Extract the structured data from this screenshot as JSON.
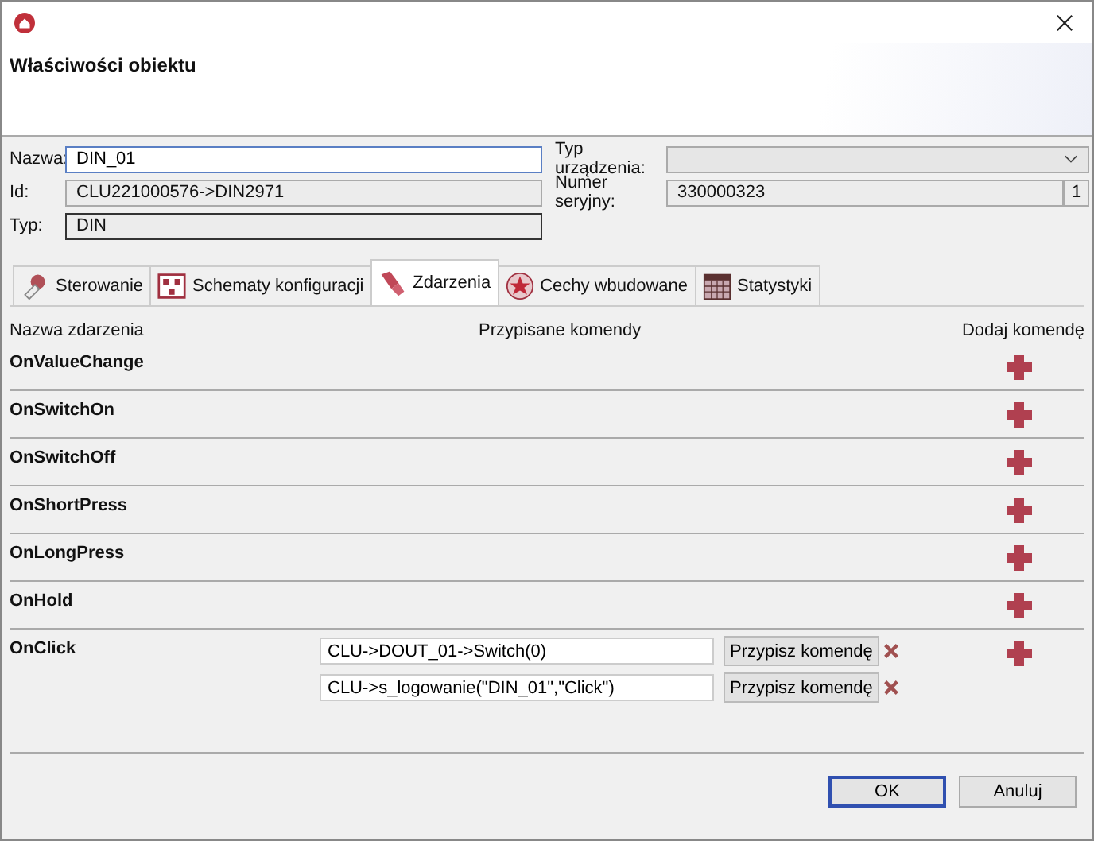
{
  "window": {
    "title": "Właściwości obiektu"
  },
  "fields": {
    "name": {
      "label": "Nazwa:",
      "value": "DIN_01"
    },
    "id": {
      "label": "Id:",
      "value": "CLU221000576->DIN2971"
    },
    "type": {
      "label": "Typ:",
      "value": "DIN"
    },
    "device_type": {
      "label": "Typ urządzenia:"
    },
    "serial": {
      "label": "Numer seryjny:",
      "value": "330000323",
      "extra": "1"
    }
  },
  "tabs": [
    {
      "label": "Sterowanie",
      "selected": false,
      "kind": "hand"
    },
    {
      "label": "Schematy konfiguracji",
      "selected": false,
      "kind": "schema"
    },
    {
      "label": "Zdarzenia",
      "selected": true,
      "kind": "brush"
    },
    {
      "label": "Cechy wbudowane",
      "selected": false,
      "kind": "star"
    },
    {
      "label": "Statystyki",
      "selected": false,
      "kind": "calendar"
    }
  ],
  "table": {
    "columns": [
      "Nazwa zdarzenia",
      "Przypisane komendy",
      "Dodaj komendę"
    ],
    "rows": [
      {
        "name": "OnValueChange",
        "commands": []
      },
      {
        "name": "OnSwitchOn",
        "commands": []
      },
      {
        "name": "OnSwitchOff",
        "commands": []
      },
      {
        "name": "OnShortPress",
        "commands": []
      },
      {
        "name": "OnLongPress",
        "commands": []
      },
      {
        "name": "OnHold",
        "commands": []
      },
      {
        "name": "OnClick",
        "commands": [
          {
            "value": "CLU->DOUT_01->Switch(0)",
            "button": "Przypisz komendę"
          },
          {
            "value": "CLU->s_logowanie(\"DIN_01\",\"Click\")",
            "button": "Przypisz komendę"
          }
        ]
      }
    ]
  },
  "buttons": [
    {
      "label": "OK",
      "default": true
    },
    {
      "label": "Anuluj",
      "default": false
    }
  ]
}
